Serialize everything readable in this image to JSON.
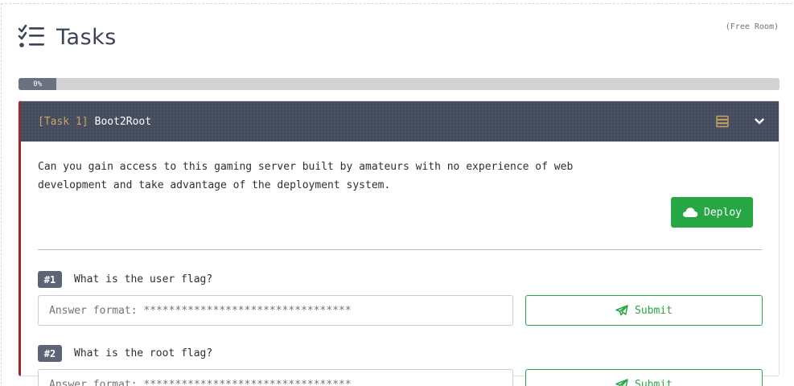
{
  "page": {
    "title": "Tasks",
    "room_type": "(Free Room)",
    "progress_label": "0%",
    "progress_fraction": 0.05,
    "icons": {
      "title": "task-list-icon"
    }
  },
  "task": {
    "label": "[Task 1]",
    "name": "Boot2Root",
    "description": "Can you gain access to this gaming server built by amateurs with no experience of web development and take advantage of the deployment system.",
    "deploy_label": "Deploy",
    "accent_color": "#a12a26",
    "header_color": "#444c5e",
    "icons": {
      "server": "server-icon",
      "toggle": "chevron-down-icon",
      "deploy": "cloud-icon"
    },
    "questions": [
      {
        "number": "#1",
        "text": "What is the user flag?",
        "placeholder": "Answer format: *********************************",
        "submit_label": "Submit"
      },
      {
        "number": "#2",
        "text": "What is the root flag?",
        "placeholder": "Answer format: *********************************",
        "submit_label": "Submit"
      }
    ]
  },
  "colors": {
    "success": "#28a745",
    "badge": "#5c6475",
    "progress_track": "#d0d2d4",
    "progress_fill": "#6b717f"
  }
}
